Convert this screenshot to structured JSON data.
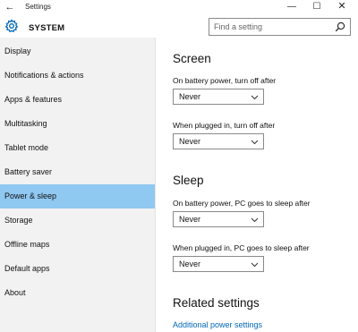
{
  "window": {
    "title": "Settings",
    "back_glyph": "←",
    "minimize_glyph": "—",
    "maximize_glyph": "☐",
    "close_glyph": "✕"
  },
  "header": {
    "section": "SYSTEM",
    "search_placeholder": "Find a setting",
    "icon": "gear-icon"
  },
  "sidebar": {
    "items": [
      {
        "label": "Display"
      },
      {
        "label": "Notifications & actions"
      },
      {
        "label": "Apps & features"
      },
      {
        "label": "Multitasking"
      },
      {
        "label": "Tablet mode"
      },
      {
        "label": "Battery saver"
      },
      {
        "label": "Power & sleep",
        "active": true
      },
      {
        "label": "Storage"
      },
      {
        "label": "Offline maps"
      },
      {
        "label": "Default apps"
      },
      {
        "label": "About"
      }
    ]
  },
  "main": {
    "screen": {
      "heading": "Screen",
      "battery_label": "On battery power, turn off after",
      "battery_value": "Never",
      "plugged_label": "When plugged in, turn off after",
      "plugged_value": "Never"
    },
    "sleep": {
      "heading": "Sleep",
      "battery_label": "On battery power, PC goes to sleep after",
      "battery_value": "Never",
      "plugged_label": "When plugged in, PC goes to sleep after",
      "plugged_value": "Never"
    },
    "related": {
      "heading": "Related settings",
      "link": "Additional power settings"
    }
  },
  "colors": {
    "accent": "#0067b8",
    "selected_nav": "#8fc8f1",
    "sidebar_bg": "#f2f2f2"
  }
}
